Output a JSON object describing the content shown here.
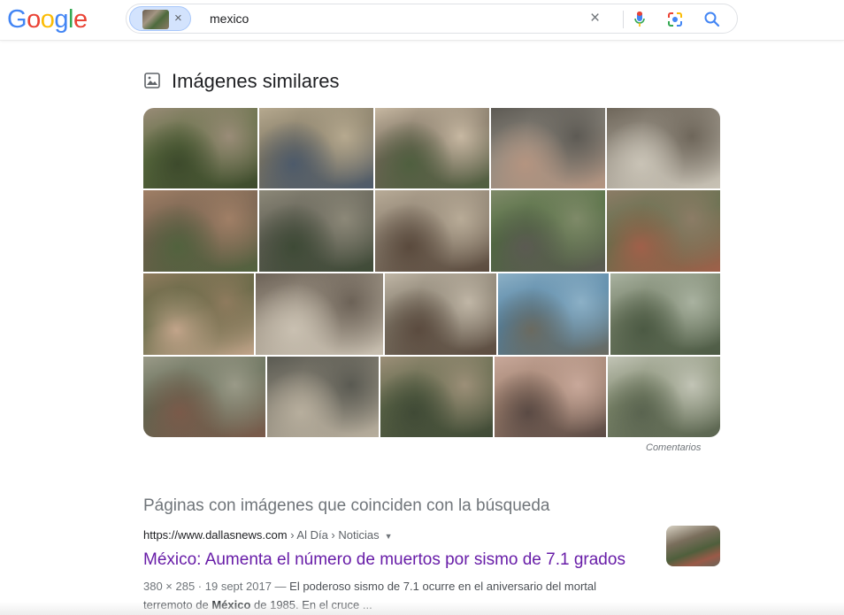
{
  "logo": {
    "letters": [
      "G",
      "o",
      "o",
      "g",
      "l",
      "e"
    ],
    "colors": [
      "#4285f4",
      "#ea4335",
      "#fbbc05",
      "#4285f4",
      "#34a853",
      "#ea4335"
    ]
  },
  "search": {
    "query": "mexico",
    "chip_close": "×",
    "clear": "×"
  },
  "similar": {
    "title": "Imágenes similares",
    "feedback": "Comentarios"
  },
  "grid_rows": [
    [
      {
        "name": "image-result-1-1",
        "c1": "#5a6b3e",
        "c2": "#9a8c78",
        "c3": "#3d4a2c"
      },
      {
        "name": "image-result-1-2",
        "c1": "#7c7460",
        "c2": "#b6a98f",
        "c3": "#4d5a6a"
      },
      {
        "name": "image-result-1-3",
        "c1": "#6f6556",
        "c2": "#c7b8a2",
        "c3": "#4f5f3f"
      },
      {
        "name": "image-result-1-4",
        "c1": "#8f8a80",
        "c2": "#5d5a54",
        "c3": "#b49480"
      },
      {
        "name": "image-result-1-5",
        "c1": "#a29b8f",
        "c2": "#6e665a",
        "c3": "#c9c3b6"
      }
    ],
    [
      {
        "name": "image-result-2-1",
        "c1": "#6e5d4c",
        "c2": "#a07f66",
        "c3": "#52623e"
      },
      {
        "name": "image-result-2-2",
        "c1": "#5d5c52",
        "c2": "#8c8878",
        "c3": "#3e4a36"
      },
      {
        "name": "image-result-2-3",
        "c1": "#867a6b",
        "c2": "#b8ab97",
        "c3": "#5a4a3d"
      },
      {
        "name": "image-result-2-4",
        "c1": "#4c6a3c",
        "c2": "#7f8a69",
        "c3": "#5b5a52"
      },
      {
        "name": "image-result-2-5",
        "c1": "#5e6e4a",
        "c2": "#8c7c66",
        "c3": "#a0604a"
      }
    ],
    [
      {
        "name": "image-result-3-1",
        "c1": "#56613d",
        "c2": "#8f7b5e",
        "c3": "#c2a48a"
      },
      {
        "name": "image-result-3-2",
        "c1": "#a69c8d",
        "c2": "#6c6257",
        "c3": "#c9c0b1"
      },
      {
        "name": "image-result-3-3",
        "c1": "#7b7364",
        "c2": "#c0b6a6",
        "c3": "#5b4b3f"
      },
      {
        "name": "image-result-3-4",
        "c1": "#4f7fa0",
        "c2": "#8cb0c6",
        "c3": "#6a6a60"
      },
      {
        "name": "image-result-3-5",
        "c1": "#6f7a62",
        "c2": "#a9b2a0",
        "c3": "#4c5a44"
      }
    ],
    [
      {
        "name": "image-result-4-1",
        "c1": "#5c6650",
        "c2": "#9a9a88",
        "c3": "#7a5a4a"
      },
      {
        "name": "image-result-4-2",
        "c1": "#8e887a",
        "c2": "#5a5a52",
        "c3": "#b7ae9d"
      },
      {
        "name": "image-result-4-3",
        "c1": "#5a6446",
        "c2": "#9c8f78",
        "c3": "#404a36"
      },
      {
        "name": "image-result-4-4",
        "c1": "#9c7e6c",
        "c2": "#c8a89a",
        "c3": "#5a4a44"
      },
      {
        "name": "image-result-4-5",
        "c1": "#7a8468",
        "c2": "#c2c4b6",
        "c3": "#5a6450"
      }
    ]
  ],
  "pages": {
    "title": "Páginas con imágenes que coinciden con la búsqueda",
    "result": {
      "url": "https://www.dallasnews.com",
      "crumbs": " › Al Día › Noticias",
      "caret": "▼",
      "title": "México: Aumenta el número de muertos por sismo de 7.1 grados",
      "meta": "380 × 285 · 19 sept 2017 — ",
      "snippet_1": "El poderoso sismo de 7.1 ocurre en el aniversario del mortal",
      "snippet_2a": "terremoto de ",
      "snippet_bold": "México",
      "snippet_2b": " de 1985. En el cruce ..."
    }
  }
}
